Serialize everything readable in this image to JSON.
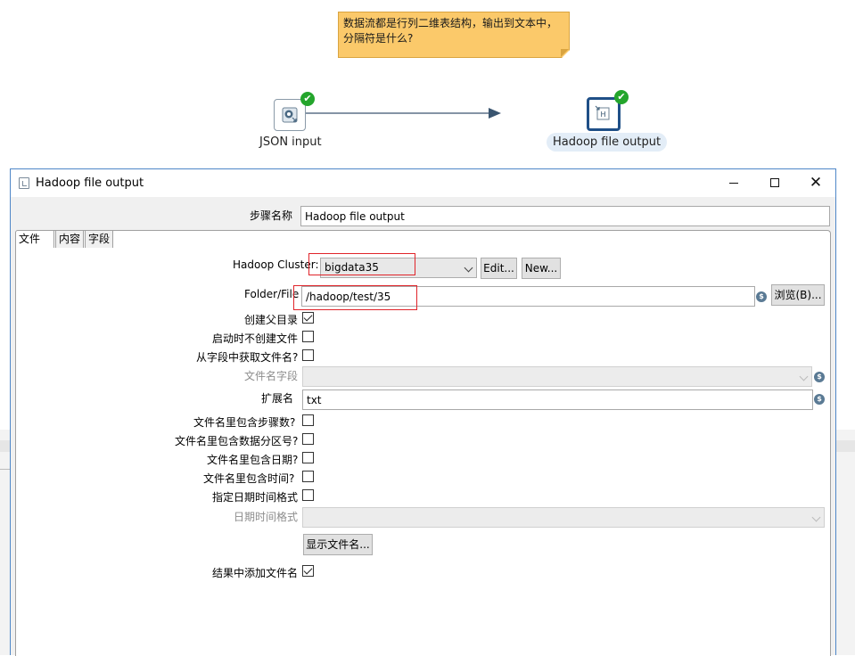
{
  "canvas": {
    "note_text": "数据流都是行列二维表结构，输出到文本中，分隔符是什么?",
    "steps": [
      {
        "label": "JSON input",
        "status": "ok"
      },
      {
        "label": "Hadoop file output",
        "status": "ok"
      }
    ],
    "check_glyph": "✔"
  },
  "dialog": {
    "title": "Hadoop file output",
    "window_controls": {
      "close": "✕"
    },
    "step_name_label": "步骤名称",
    "step_name_value": "Hadoop file output",
    "tabs": [
      {
        "label": "文件",
        "active": true
      },
      {
        "label": "内容",
        "active": false
      },
      {
        "label": "字段",
        "active": false
      }
    ],
    "file_tab": {
      "cluster_label": "Hadoop Cluster:",
      "cluster_value": "bigdata35",
      "edit_button": "Edit...",
      "new_button": "New...",
      "folder_label": "Folder/File",
      "folder_value": "/hadoop/test/35",
      "browse_button": "浏览(B)...",
      "create_parent_label": "创建父目录",
      "create_parent_checked": true,
      "no_create_on_start_label": "启动时不创建文件",
      "no_create_on_start_checked": false,
      "filename_from_field_label": "从字段中获取文件名?",
      "filename_from_field_checked": false,
      "filename_field_label": "文件名字段",
      "filename_field_value": "",
      "extension_label": "扩展名",
      "extension_value": "txt",
      "include_stepnr_label": "文件名里包含步骤数?",
      "include_stepnr_checked": false,
      "include_partition_label": "文件名里包含数据分区号?",
      "include_partition_checked": false,
      "include_date_label": "文件名里包含日期?",
      "include_date_checked": false,
      "include_time_label": "文件名里包含时间?",
      "include_time_checked": false,
      "specify_datetime_label": "指定日期时间格式",
      "specify_datetime_checked": false,
      "datetime_format_label": "日期时间格式",
      "datetime_format_value": "",
      "show_filename_button": "显示文件名...",
      "add_to_result_label": "结果中添加文件名",
      "add_to_result_checked": true
    },
    "variable_icon_glyph": "$"
  },
  "colors": {
    "note_bg": "#fbc96a",
    "ok_green": "#24a52c",
    "selected_step_border": "#1f4f87",
    "highlight_red": "#e0242a",
    "dialog_border": "#4f87c8"
  }
}
